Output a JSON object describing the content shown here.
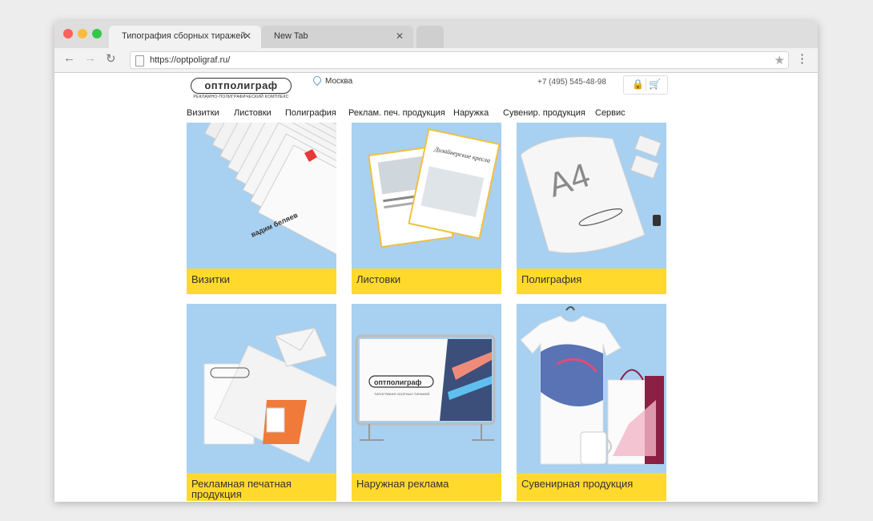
{
  "browser": {
    "tabs": [
      {
        "title": "Типография сборных тиражей",
        "close": "✕"
      },
      {
        "title": "New Tab",
        "close": "✕"
      }
    ],
    "url": "https://optpoligraf.ru/",
    "back_icon": "←",
    "forward_icon": "→",
    "reload_icon": "↻",
    "star_icon": "★",
    "menu_icon": "⋮"
  },
  "header": {
    "logo_text": "оптполиграф",
    "logo_tagline": "РЕКЛАМНО-ПОЛИГРАФИЧЕСКИЙ КОМПЛЕКС",
    "city": "Москва",
    "phone": "+7 (495) 545-48-98",
    "lock_icon": "🔒",
    "cart_icon": "🛒"
  },
  "nav": [
    "Визитки",
    "Листовки",
    "Полиграфия",
    "Реклам. печ. продукция",
    "Наружка",
    "Сувенир. продукция",
    "Сервис"
  ],
  "cards": [
    {
      "label": "Визитки",
      "card_name": "вадим беляев"
    },
    {
      "label": "Листовки",
      "flyer_text": "Дизайнерские кресла"
    },
    {
      "label": "Полиграфия",
      "paper_text": "A4"
    },
    {
      "label": "Рекламная печатная продукция"
    },
    {
      "label": "Наружная реклама",
      "banner_brand": "оптполиграф",
      "banner_tagline": "ТИПОГРАФИЯ СБОРНЫХ ТИРАЖЕЙ"
    },
    {
      "label": "Сувенирная продукция"
    }
  ],
  "colors": {
    "card_bg": "#a8d0f0",
    "caption_bg": "#ffd92b",
    "accent_red": "#e53935"
  }
}
